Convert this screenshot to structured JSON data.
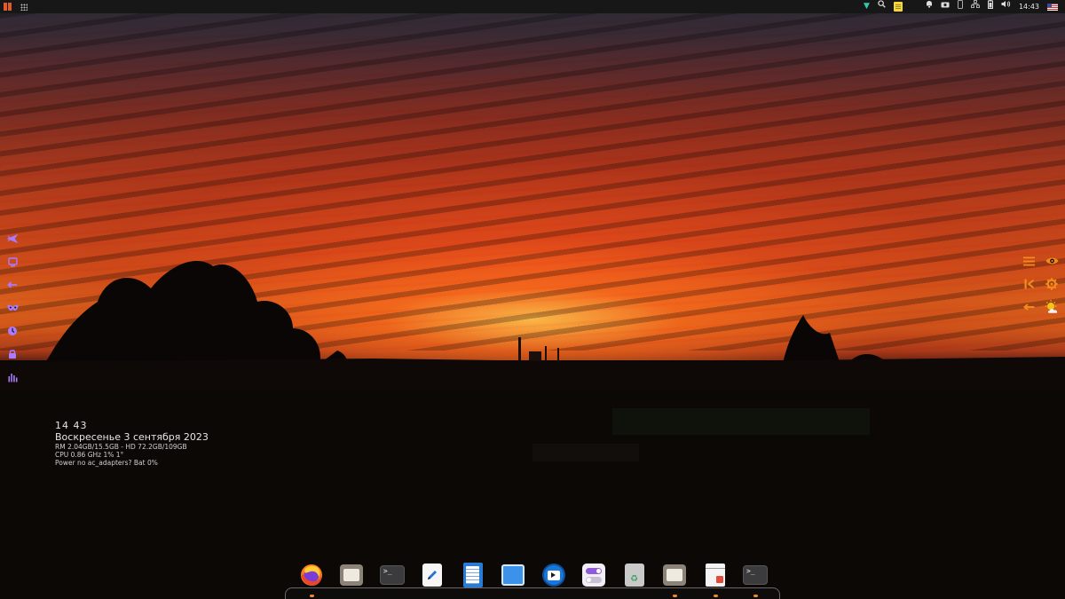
{
  "top_panel": {
    "clock": "14:43",
    "keyboard_layout_flag": "us-flag",
    "left_icons": [
      "app-menu-icon",
      "apps-grid-icon"
    ],
    "tray_icons": [
      "chevron-down-icon",
      "search-icon",
      "sticky-notes-icon",
      "bell-icon",
      "camera-icon",
      "phone-icon",
      "network-icon",
      "battery-icon",
      "volume-icon"
    ]
  },
  "left_rail": {
    "icons": [
      "airplane-icon",
      "monitor-icon",
      "arrow-left-icon",
      "mask-icon",
      "clock-icon",
      "lock-icon",
      "bar-chart-icon"
    ]
  },
  "right_rail": {
    "icons": [
      "hamburger-menu-icon",
      "eye-icon",
      "skip-back-icon",
      "gear-icon",
      "arrow-left-icon",
      "weather-sun-icon"
    ]
  },
  "sysinfo": {
    "time": "14 43",
    "date": "Воскресенье  3 сентября 2023",
    "memory": "RM 2.04GB/15.5GB - HD 72.2GB/109GB",
    "cpu": "CPU 0.86 GHz 1% 1°",
    "power": "Power no ac_adapters? Bat 0%"
  },
  "dock": {
    "items": [
      {
        "name": "firefox",
        "icon": "firefox-icon",
        "running": true
      },
      {
        "name": "files",
        "icon": "folder-icon",
        "running": false
      },
      {
        "name": "terminal",
        "icon": "terminal-icon",
        "running": false
      },
      {
        "name": "text-editor",
        "icon": "text-editor-icon",
        "running": false
      },
      {
        "name": "writer",
        "icon": "document-icon",
        "running": false
      },
      {
        "name": "window",
        "icon": "window-icon",
        "running": false
      },
      {
        "name": "video-player",
        "icon": "video-player-icon",
        "running": false
      },
      {
        "name": "settings",
        "icon": "settings-toggle-icon",
        "running": false
      },
      {
        "name": "trash",
        "icon": "trash-icon",
        "running": false
      },
      {
        "name": "files-2",
        "icon": "folder-icon",
        "running": true
      },
      {
        "name": "news",
        "icon": "news-icon",
        "running": true
      },
      {
        "name": "terminal-2",
        "icon": "terminal-icon",
        "running": true
      }
    ],
    "terminal_glyph": ">_"
  },
  "colors": {
    "panel_bg": "#171717",
    "left_rail_accent": "#a97bff",
    "right_rail_accent": "#f28b1c",
    "dock_running_dot": "#f08a20"
  }
}
